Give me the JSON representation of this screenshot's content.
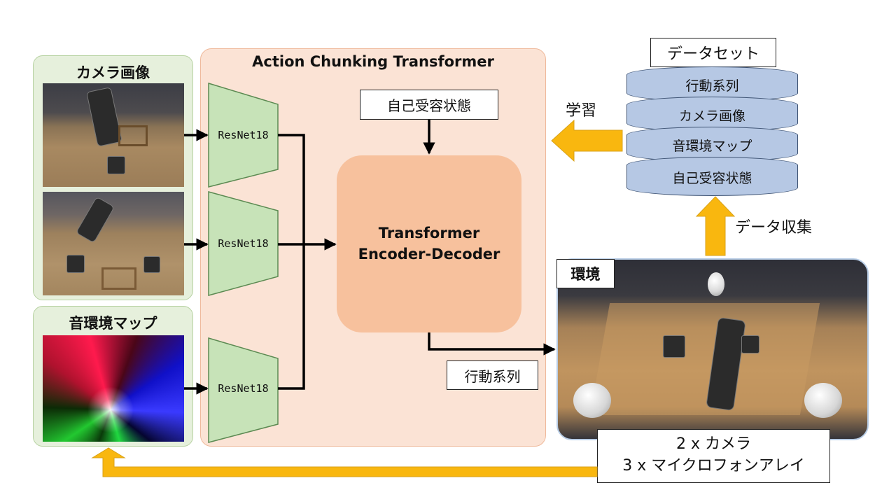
{
  "camera_panel": {
    "title": "カメラ画像"
  },
  "acoustic_panel": {
    "title": "音環境マップ"
  },
  "act": {
    "title": "Action Chunking Transformer",
    "encoder_label": "ResNet18",
    "proprioception": "自己受容状態",
    "transformer_line1": "Transformer",
    "transformer_line2": "Encoder-Decoder",
    "output_label": "行動系列"
  },
  "dataset": {
    "title": "データセット",
    "items": [
      "行動系列",
      "カメラ画像",
      "音環境マップ",
      "自己受容状態"
    ]
  },
  "learn_label": "学習",
  "collect_label": "データ収集",
  "environment": {
    "title": "環境",
    "note_line1": "2 x カメラ",
    "note_line2": "3 x マイクロフォンアレイ"
  },
  "colors": {
    "arrow_gold": "#f9b70f",
    "arrow_gold_edge": "#d9a218",
    "panel_green": "#e6f0dc",
    "panel_act": "#fbe3d5",
    "transformer": "#f7c19d",
    "encoder": "#c7e3b8",
    "disk": "#b6c8e4"
  }
}
